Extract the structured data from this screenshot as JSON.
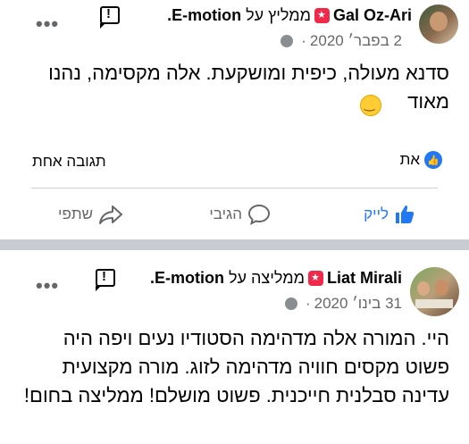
{
  "posts": [
    {
      "author": "Gal Oz-Ari",
      "recommends_text": "ממליץ על",
      "page": "E-motion.",
      "date": "2 בפבר׳ 2020",
      "dot": "·",
      "body": "סדנא מעולה, כיפית ומושקעת. אלה מקסימה, נהנו מאוד",
      "reactions_label": "את",
      "comments_label": "תגובה אחת",
      "actions": {
        "like": "לייק",
        "comment": "הגיבי",
        "share": "שתפי"
      }
    },
    {
      "author": "Liat Mirali",
      "recommends_text": "ממליצה על",
      "page": "E-motion.",
      "date": "31 בינו׳ 2020",
      "dot": "·",
      "body": "היי. המורה אלה מדהימה הסטודיו נעים ויפה היה פשוט מקסים חוויה מדהימה לזוג. מורה מקצועית עדינה סבלנית חייכנית. פשוט מושלם! ממליצה בחום!"
    }
  ],
  "more_icon": "more-horizontal-icon",
  "colors": {
    "accent": "#2078f4",
    "recommend": "#f02849",
    "muted": "#65676b",
    "separator": "#c9ccd1"
  }
}
